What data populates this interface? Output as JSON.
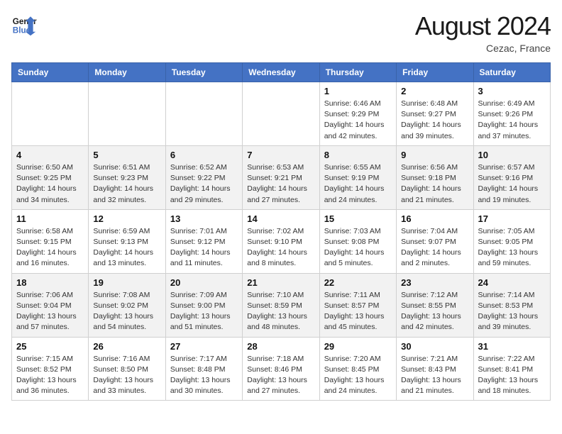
{
  "header": {
    "logo_line1": "General",
    "logo_line2": "Blue",
    "month_title": "August 2024",
    "location": "Cezac, France"
  },
  "days_of_week": [
    "Sunday",
    "Monday",
    "Tuesday",
    "Wednesday",
    "Thursday",
    "Friday",
    "Saturday"
  ],
  "weeks": [
    [
      {
        "day": "",
        "info": ""
      },
      {
        "day": "",
        "info": ""
      },
      {
        "day": "",
        "info": ""
      },
      {
        "day": "",
        "info": ""
      },
      {
        "day": "1",
        "info": "Sunrise: 6:46 AM\nSunset: 9:29 PM\nDaylight: 14 hours\nand 42 minutes."
      },
      {
        "day": "2",
        "info": "Sunrise: 6:48 AM\nSunset: 9:27 PM\nDaylight: 14 hours\nand 39 minutes."
      },
      {
        "day": "3",
        "info": "Sunrise: 6:49 AM\nSunset: 9:26 PM\nDaylight: 14 hours\nand 37 minutes."
      }
    ],
    [
      {
        "day": "4",
        "info": "Sunrise: 6:50 AM\nSunset: 9:25 PM\nDaylight: 14 hours\nand 34 minutes."
      },
      {
        "day": "5",
        "info": "Sunrise: 6:51 AM\nSunset: 9:23 PM\nDaylight: 14 hours\nand 32 minutes."
      },
      {
        "day": "6",
        "info": "Sunrise: 6:52 AM\nSunset: 9:22 PM\nDaylight: 14 hours\nand 29 minutes."
      },
      {
        "day": "7",
        "info": "Sunrise: 6:53 AM\nSunset: 9:21 PM\nDaylight: 14 hours\nand 27 minutes."
      },
      {
        "day": "8",
        "info": "Sunrise: 6:55 AM\nSunset: 9:19 PM\nDaylight: 14 hours\nand 24 minutes."
      },
      {
        "day": "9",
        "info": "Sunrise: 6:56 AM\nSunset: 9:18 PM\nDaylight: 14 hours\nand 21 minutes."
      },
      {
        "day": "10",
        "info": "Sunrise: 6:57 AM\nSunset: 9:16 PM\nDaylight: 14 hours\nand 19 minutes."
      }
    ],
    [
      {
        "day": "11",
        "info": "Sunrise: 6:58 AM\nSunset: 9:15 PM\nDaylight: 14 hours\nand 16 minutes."
      },
      {
        "day": "12",
        "info": "Sunrise: 6:59 AM\nSunset: 9:13 PM\nDaylight: 14 hours\nand 13 minutes."
      },
      {
        "day": "13",
        "info": "Sunrise: 7:01 AM\nSunset: 9:12 PM\nDaylight: 14 hours\nand 11 minutes."
      },
      {
        "day": "14",
        "info": "Sunrise: 7:02 AM\nSunset: 9:10 PM\nDaylight: 14 hours\nand 8 minutes."
      },
      {
        "day": "15",
        "info": "Sunrise: 7:03 AM\nSunset: 9:08 PM\nDaylight: 14 hours\nand 5 minutes."
      },
      {
        "day": "16",
        "info": "Sunrise: 7:04 AM\nSunset: 9:07 PM\nDaylight: 14 hours\nand 2 minutes."
      },
      {
        "day": "17",
        "info": "Sunrise: 7:05 AM\nSunset: 9:05 PM\nDaylight: 13 hours\nand 59 minutes."
      }
    ],
    [
      {
        "day": "18",
        "info": "Sunrise: 7:06 AM\nSunset: 9:04 PM\nDaylight: 13 hours\nand 57 minutes."
      },
      {
        "day": "19",
        "info": "Sunrise: 7:08 AM\nSunset: 9:02 PM\nDaylight: 13 hours\nand 54 minutes."
      },
      {
        "day": "20",
        "info": "Sunrise: 7:09 AM\nSunset: 9:00 PM\nDaylight: 13 hours\nand 51 minutes."
      },
      {
        "day": "21",
        "info": "Sunrise: 7:10 AM\nSunset: 8:59 PM\nDaylight: 13 hours\nand 48 minutes."
      },
      {
        "day": "22",
        "info": "Sunrise: 7:11 AM\nSunset: 8:57 PM\nDaylight: 13 hours\nand 45 minutes."
      },
      {
        "day": "23",
        "info": "Sunrise: 7:12 AM\nSunset: 8:55 PM\nDaylight: 13 hours\nand 42 minutes."
      },
      {
        "day": "24",
        "info": "Sunrise: 7:14 AM\nSunset: 8:53 PM\nDaylight: 13 hours\nand 39 minutes."
      }
    ],
    [
      {
        "day": "25",
        "info": "Sunrise: 7:15 AM\nSunset: 8:52 PM\nDaylight: 13 hours\nand 36 minutes."
      },
      {
        "day": "26",
        "info": "Sunrise: 7:16 AM\nSunset: 8:50 PM\nDaylight: 13 hours\nand 33 minutes."
      },
      {
        "day": "27",
        "info": "Sunrise: 7:17 AM\nSunset: 8:48 PM\nDaylight: 13 hours\nand 30 minutes."
      },
      {
        "day": "28",
        "info": "Sunrise: 7:18 AM\nSunset: 8:46 PM\nDaylight: 13 hours\nand 27 minutes."
      },
      {
        "day": "29",
        "info": "Sunrise: 7:20 AM\nSunset: 8:45 PM\nDaylight: 13 hours\nand 24 minutes."
      },
      {
        "day": "30",
        "info": "Sunrise: 7:21 AM\nSunset: 8:43 PM\nDaylight: 13 hours\nand 21 minutes."
      },
      {
        "day": "31",
        "info": "Sunrise: 7:22 AM\nSunset: 8:41 PM\nDaylight: 13 hours\nand 18 minutes."
      }
    ]
  ]
}
